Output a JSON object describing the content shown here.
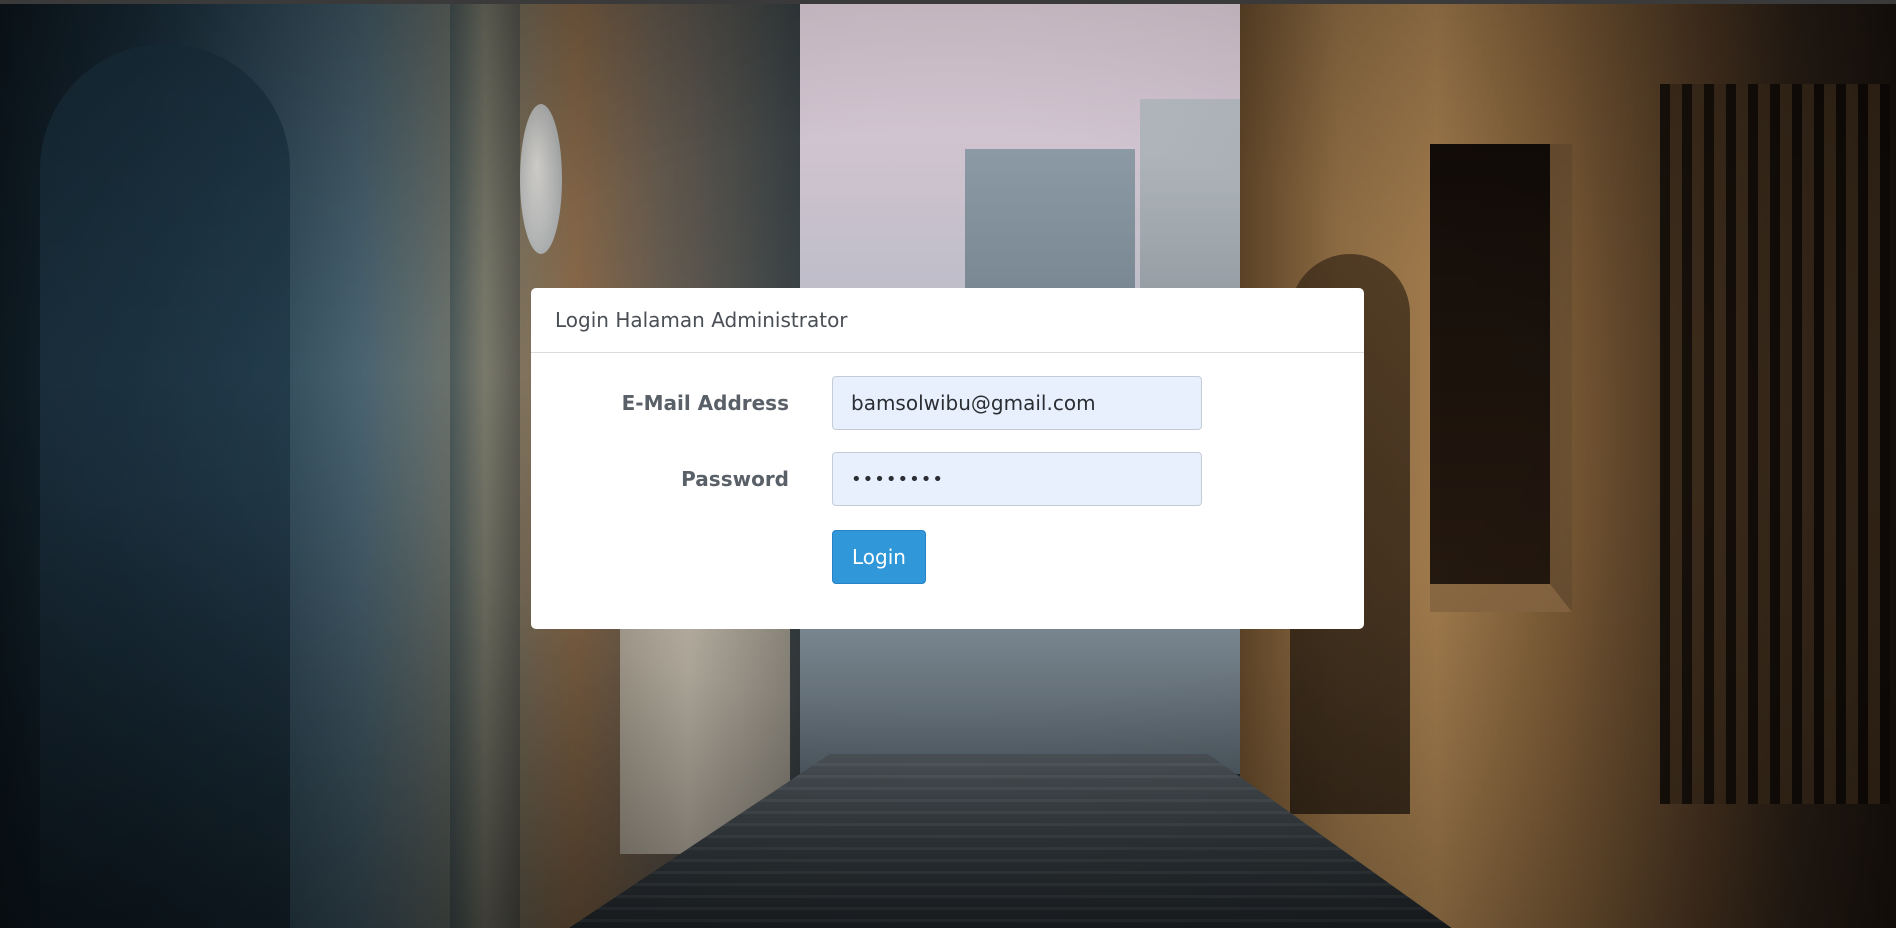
{
  "page": {
    "background": "street photo between old buildings"
  },
  "login_card": {
    "title": "Login Halaman Administrator",
    "email": {
      "label": "E-Mail Address",
      "value": "bamsolwibu@gmail.com"
    },
    "password": {
      "label": "Password",
      "value": "••••••••"
    },
    "submit_label": "Login"
  },
  "colors": {
    "card_bg": "#ffffff",
    "input_bg": "#e8f0fe",
    "button_bg": "#3097d9",
    "button_text": "#ffffff",
    "label_text": "#5a6068"
  }
}
